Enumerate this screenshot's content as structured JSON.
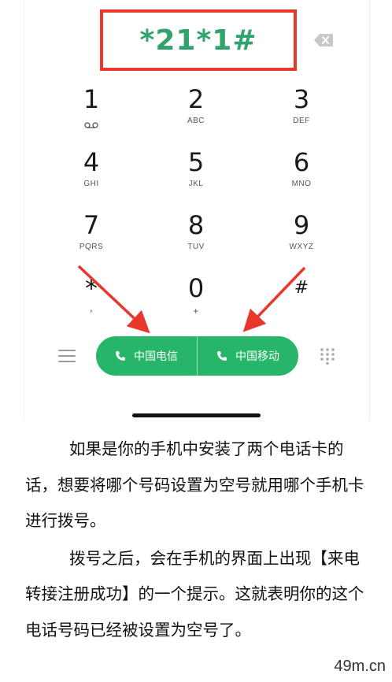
{
  "dialer": {
    "number": "*21*1#",
    "keys": [
      {
        "digit": "1",
        "letters": ""
      },
      {
        "digit": "2",
        "letters": "ABC"
      },
      {
        "digit": "3",
        "letters": "DEF"
      },
      {
        "digit": "4",
        "letters": "GHI"
      },
      {
        "digit": "5",
        "letters": "JKL"
      },
      {
        "digit": "6",
        "letters": "MNO"
      },
      {
        "digit": "7",
        "letters": "PQRS"
      },
      {
        "digit": "8",
        "letters": "TUV"
      },
      {
        "digit": "9",
        "letters": "WXYZ"
      },
      {
        "digit": "*",
        "letters": ","
      },
      {
        "digit": "0",
        "letters": "+"
      },
      {
        "digit": "#",
        "letters": ""
      }
    ],
    "call_buttons": [
      {
        "label": "中国电信"
      },
      {
        "label": "中国移动"
      }
    ],
    "icons": {
      "backspace": "backspace-icon",
      "voicemail": "voicemail-icon",
      "menu": "menu-icon",
      "phone": "phone-icon",
      "keypad": "keypad-grid-icon"
    },
    "colors": {
      "number": "#2fa36b",
      "highlight_box": "#e8372b",
      "call_button": "#27b56a",
      "arrow": "#e8372b"
    }
  },
  "article": {
    "paragraphs": [
      "如果是你的手机中安装了两个电话卡的话，想要将哪个号码设置为空号就用哪个手机卡进行拨号。",
      "拨号之后，会在手机的界面上出现【来电转接注册成功】的一个提示。这就表明你的这个电话号码已经被设置为空号了。"
    ]
  },
  "watermark": "49m.cn"
}
